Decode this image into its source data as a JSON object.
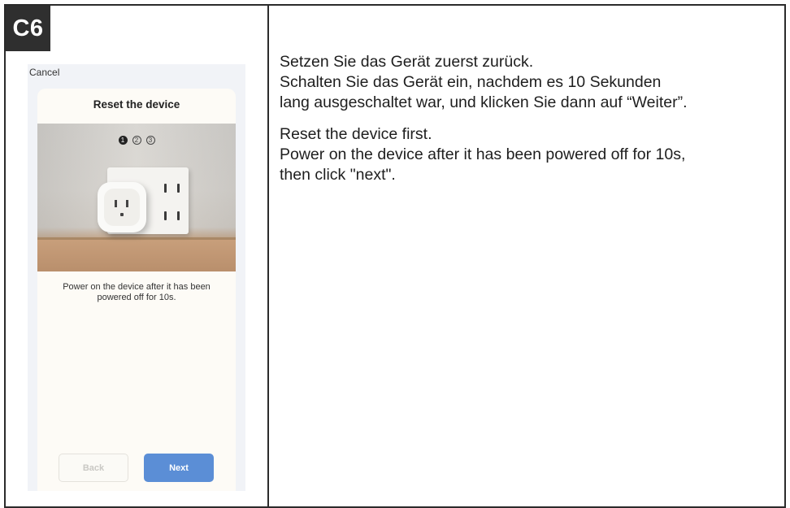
{
  "step_badge": "C6",
  "phone": {
    "cancel_label": "Cancel",
    "title": "Reset the device",
    "step_indicators": [
      "1",
      "2",
      "3"
    ],
    "active_step": 1,
    "instruction": "Power on the device after it has been powered off for 10s.",
    "back_label": "Back",
    "next_label": "Next"
  },
  "text": {
    "de_line1": "Setzen Sie das Gerät zuerst zurück.",
    "de_line2": "Schalten Sie das Gerät ein, nachdem es 10 Sekunden",
    "de_line3": "lang ausgeschaltet war, und klicken Sie dann auf “Weiter”.",
    "en_line1": "Reset the device first.",
    "en_line2": "Power on the device after it has been powered off for 10s,",
    "en_line3": "then click \"next\"."
  },
  "colors": {
    "badge": "#2f2f2f",
    "next_button": "#5b8ed6",
    "card_background": "#fdfbf6"
  }
}
